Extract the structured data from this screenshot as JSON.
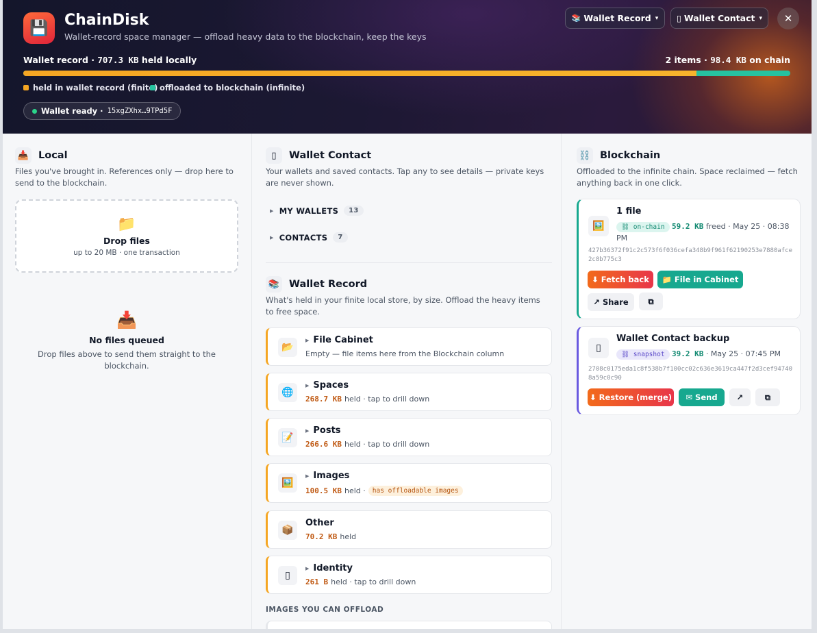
{
  "app": {
    "title": "ChainDisk",
    "subtitle": "Wallet-record space manager — offload heavy data to the blockchain, keep the keys",
    "logo_icon": "💾",
    "close_label": "✕"
  },
  "header_buttons": {
    "wallet_record": "Wallet Record",
    "wallet_record_icon": "📚",
    "wallet_contact": "Wallet Contact",
    "wallet_contact_icon": "▯",
    "caret": "▾"
  },
  "usage": {
    "left_prefix": "Wallet record · ",
    "left_size": "707.3 KB",
    "left_suffix": " held locally",
    "right_prefix": "2 items · ",
    "right_size": "98.4 KB",
    "right_suffix": " on chain",
    "local_fraction": 0.878,
    "legend_local": "held in wallet record (finite)",
    "legend_chain": "offloaded to blockchain (infinite)",
    "local_color": "#f5a623",
    "chain_color": "#26c2a0"
  },
  "wallet_status": {
    "label": "Wallet ready ·",
    "address": "15xgZXhx…9TPd5F"
  },
  "local": {
    "icon": "📥",
    "title": "Local",
    "desc": "Files you've brought in. References only — drop here to send to the blockchain.",
    "drop_icon": "📁",
    "drop_title": "Drop files",
    "drop_sub": "up to 20 MB · one transaction",
    "empty_icon": "📥",
    "empty_title": "No files queued",
    "empty_sub": "Drop files above to send them straight to the blockchain."
  },
  "contact": {
    "icon": "▯",
    "title": "Wallet Contact",
    "desc": "Your wallets and saved contacts. Tap any to see details — private keys are never shown.",
    "sections": [
      {
        "label": "MY WALLETS",
        "count": "13"
      },
      {
        "label": "CONTACTS",
        "count": "7"
      }
    ]
  },
  "record": {
    "icon": "📚",
    "title": "Wallet Record",
    "desc": "What's held in your finite local store, by size. Offload the heavy items to free space.",
    "items": [
      {
        "icon": "📂",
        "title": "File Cabinet",
        "sub": "Empty — file items here from the Blockchain column"
      },
      {
        "icon": "🌐",
        "title": "Spaces",
        "size": "268.7 KB",
        "sub": "held · tap to drill down"
      },
      {
        "icon": "📝",
        "title": "Posts",
        "size": "266.6 KB",
        "sub": "held · tap to drill down"
      },
      {
        "icon": "🖼️",
        "title": "Images",
        "size": "100.5 KB",
        "sub": "held ·",
        "tag": "has offloadable images"
      },
      {
        "icon": "📦",
        "title": "Other",
        "size": "70.2 KB",
        "sub": "held"
      },
      {
        "icon": "▯",
        "title": "Identity",
        "size": "261 B",
        "sub": "held · tap to drill down"
      }
    ],
    "images_heading": "IMAGES YOU CAN OFFLOAD"
  },
  "chain": {
    "icon": "⛓️",
    "title": "Blockchain",
    "desc": "Offloaded to the infinite chain. Space reclaimed — fetch anything back in one click.",
    "cards": [
      {
        "icon": "🖼️",
        "title": "1 file",
        "tag": "⛓ on-chain",
        "size": "59.2 KB",
        "meta": "freed · May 25 · 08:38 PM",
        "hash": "427b36372f91c2c573f6f036cefa348b9f961f62190253e7880afce2c8b775c3",
        "buttons": [
          "⬇ Fetch back",
          "📁 File in Cabinet",
          "↗ Share",
          "⧉"
        ]
      },
      {
        "icon": "▯",
        "title": "Wallet Contact backup",
        "tag": "⛓ snapshot",
        "size": "39.2 KB",
        "meta": "· May 25 · 07:45 PM",
        "hash": "2708c0175eda1c8f538b7f100cc02c636e3619ca447f2d3cef947408a59c0c90",
        "buttons": [
          "⬇ Restore (merge)",
          "✉ Send",
          "↗",
          "⧉"
        ]
      }
    ]
  }
}
